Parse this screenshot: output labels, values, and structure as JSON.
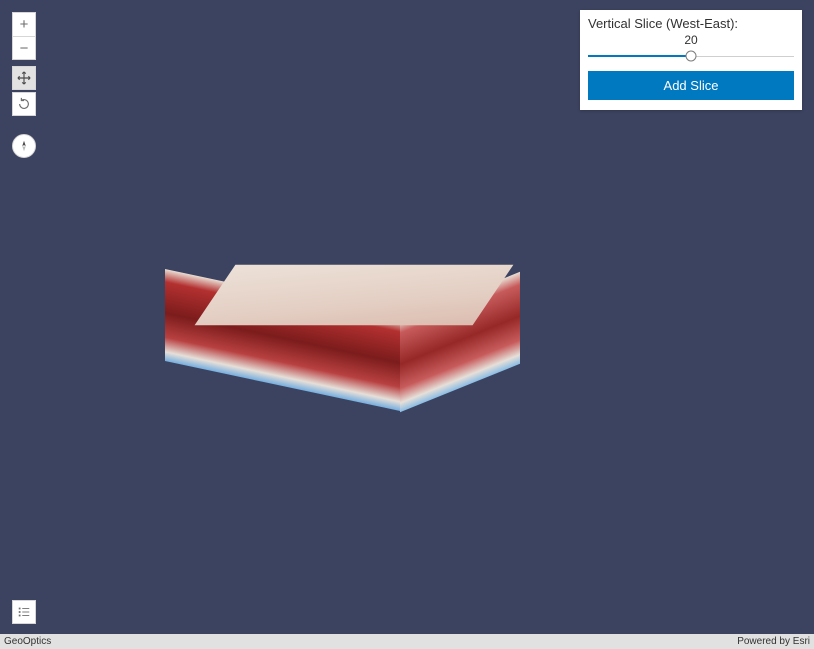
{
  "nav": {
    "zoom_in_title": "Zoom in",
    "zoom_out_title": "Zoom out",
    "pan_title": "Pan",
    "rotate_title": "Rotate",
    "compass_title": "Reset compass orientation"
  },
  "slice_panel": {
    "label": "Vertical Slice (West-East):",
    "value": "20",
    "min": 0,
    "max": 40,
    "button_label": "Add Slice"
  },
  "legend": {
    "title": "Legend"
  },
  "attribution": {
    "left": "GeoOptics",
    "right": "Powered by Esri"
  },
  "colors": {
    "accent": "#0079c1",
    "background": "#3c4360"
  }
}
